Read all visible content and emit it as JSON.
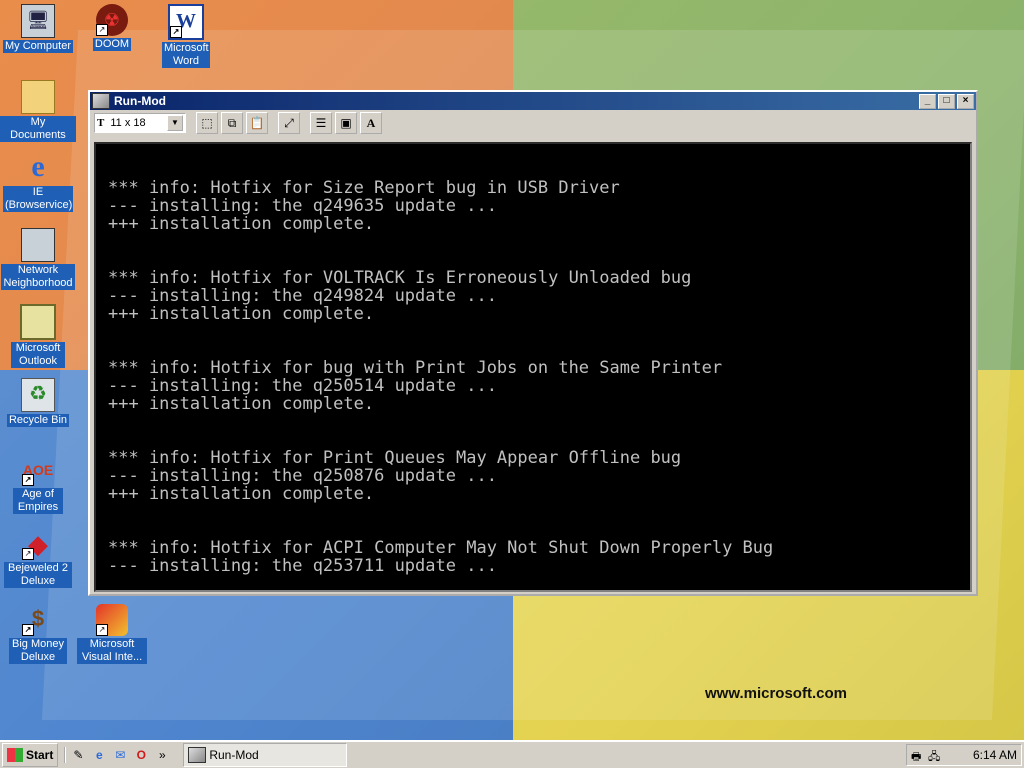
{
  "desktop": {
    "icons": [
      {
        "label": "My Computer",
        "glyph": "🖥"
      },
      {
        "label": "DOOM",
        "glyph": "☢"
      },
      {
        "label": "Microsoft Word",
        "glyph": "W"
      },
      {
        "label": "My Documents",
        "glyph": "📁"
      },
      {
        "label": "IE (Browservice)",
        "glyph": "e"
      },
      {
        "label": "Network Neighborhood",
        "glyph": "🖧"
      },
      {
        "label": "Microsoft Outlook",
        "glyph": "✉"
      },
      {
        "label": "Recycle Bin",
        "glyph": "♻"
      },
      {
        "label": "Age of Empires",
        "glyph": "AOE"
      },
      {
        "label": "Bejeweled 2 Deluxe",
        "glyph": "◆"
      },
      {
        "label": "Big Money Deluxe",
        "glyph": "$"
      },
      {
        "label": "Microsoft Visual Inte...",
        "glyph": "✎"
      }
    ],
    "wallpaper_text": "www.microsoft.com"
  },
  "window": {
    "title": "Run-Mod",
    "font_size_value": "11 x 18",
    "console_lines": [
      {
        "type": "info",
        "text": "*** info: Hotfix for Size Report bug in USB Driver"
      },
      {
        "type": "install",
        "text": "--- installing: the q249635 update ..."
      },
      {
        "type": "done",
        "text": "+++ installation complete."
      },
      {
        "type": "info",
        "text": "*** info: Hotfix for VOLTRACK Is Erroneously Unloaded bug"
      },
      {
        "type": "install",
        "text": "--- installing: the q249824 update ..."
      },
      {
        "type": "done",
        "text": "+++ installation complete."
      },
      {
        "type": "info",
        "text": "*** info: Hotfix for bug with Print Jobs on the Same Printer"
      },
      {
        "type": "install",
        "text": "--- installing: the q250514 update ..."
      },
      {
        "type": "done",
        "text": "+++ installation complete."
      },
      {
        "type": "info",
        "text": "*** info: Hotfix for Print Queues May Appear Offline bug"
      },
      {
        "type": "install",
        "text": "--- installing: the q250876 update ..."
      },
      {
        "type": "done",
        "text": "+++ installation complete."
      },
      {
        "type": "info",
        "text": "*** info: Hotfix for ACPI Computer May Not Shut Down Properly Bug"
      },
      {
        "type": "install",
        "text": "--- installing: the q253711 update ..."
      }
    ]
  },
  "taskbar": {
    "start_label": "Start",
    "quicklaunch_more": "»",
    "task_label": "Run-Mod",
    "clock": "6:14 AM"
  }
}
